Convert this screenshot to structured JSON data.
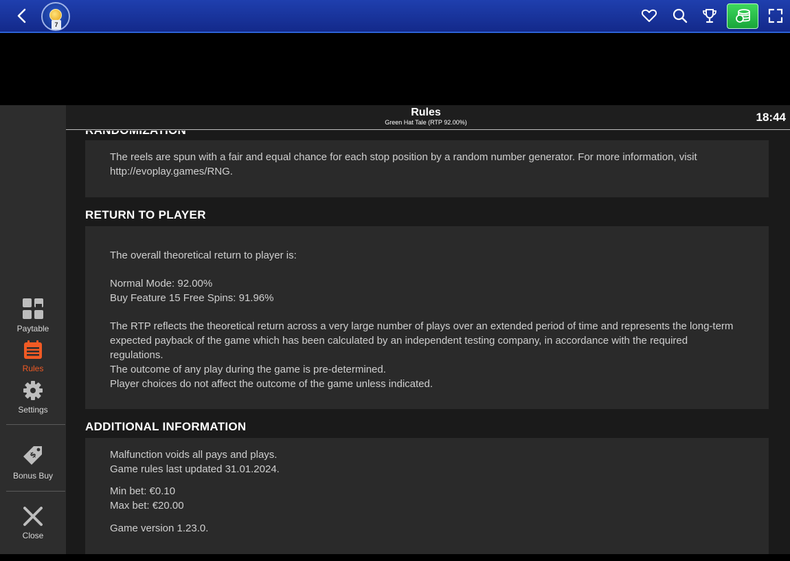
{
  "topbar": {
    "back_icon": "chevron-left-icon",
    "avatar_level": "7",
    "icons": [
      "heart-icon",
      "search-icon",
      "trophy-icon",
      "cashier-icon",
      "fullscreen-icon"
    ]
  },
  "sidebar": {
    "items": [
      {
        "label": "Paytable",
        "icon": "paytable-grid-icon"
      },
      {
        "label": "Rules",
        "icon": "rules-calendar-icon"
      },
      {
        "label": "Settings",
        "icon": "gear-icon"
      },
      {
        "label": "Bonus Buy",
        "icon": "price-tag-icon"
      },
      {
        "label": "Close",
        "icon": "close-icon"
      }
    ],
    "active_color": "#f15a24"
  },
  "header": {
    "title": "Rules",
    "subtitle": "Green Hat Tale (RTP 92.00%)",
    "clock": "18:44"
  },
  "content": {
    "partial_heading": "RANDOMIZATION",
    "randomization": {
      "text": "The reels are spun with a fair and equal chance for each stop position by a random number generator. For more information, visit http://evoplay.games/RNG."
    },
    "rtp": {
      "heading": "RETURN TO PLAYER",
      "intro": "The overall theoretical return to player is:",
      "normal_mode": "Normal Mode: 92.00%",
      "buy_feature": "Buy Feature 15 Free Spins: 91.96%",
      "description": "The RTP reflects the theoretical return across a very large number of plays over an extended period of time and represents the long-term expected payback of the game which has been calculated by an independent testing company, in accordance with the required regulations.",
      "outcome": "The outcome of any play during the game is pre-determined.",
      "choices": "Player choices do not affect the outcome of the game unless indicated."
    },
    "additional": {
      "heading": "ADDITIONAL INFORMATION",
      "malfunction": "Malfunction voids all pays and plays.",
      "updated": "Game rules last updated 31.01.2024.",
      "min_bet": "Min bet: €0.10",
      "max_bet": "Max bet: €20.00",
      "version": "Game version 1.23.0."
    }
  }
}
